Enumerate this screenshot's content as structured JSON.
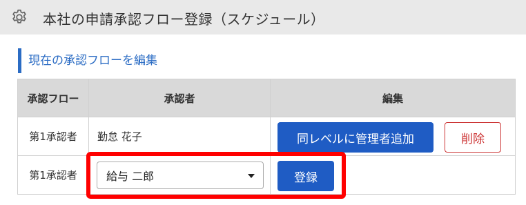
{
  "header": {
    "title": "本社の申請承認フロー登録（スケジュール）",
    "icon": "gear-icon"
  },
  "section": {
    "title": "現在の承認フローを編集"
  },
  "table": {
    "headers": [
      "承認フロー",
      "承認者",
      "編集"
    ],
    "rows": [
      {
        "flow": "第1承認者",
        "approver": "勤怠 花子",
        "add_button": "同レベルに管理者追加",
        "delete_button": "削除"
      },
      {
        "flow": "第1承認者",
        "approver_select_value": "給与 二郎",
        "register_button": "登録"
      }
    ]
  },
  "colors": {
    "accent": "#1f5cc4",
    "danger": "#cc3333",
    "highlight": "#ff0000",
    "header_bg": "#e9e9e9"
  }
}
